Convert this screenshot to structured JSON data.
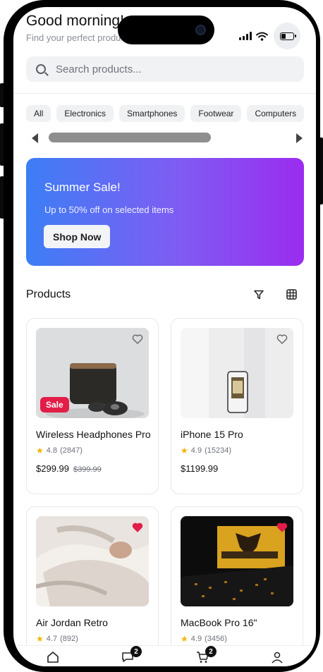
{
  "header": {
    "greeting": "Good morning!",
    "subtitle": "Find your perfect products"
  },
  "search": {
    "placeholder": "Search products..."
  },
  "categories": [
    "All",
    "Electronics",
    "Smartphones",
    "Footwear",
    "Computers"
  ],
  "banner": {
    "title": "Summer Sale!",
    "subtitle": "Up to 50% off on selected items",
    "button": "Shop Now"
  },
  "products_section": {
    "title": "Products"
  },
  "products": [
    {
      "name": "Wireless Headphones Pro",
      "rating": "4.8",
      "reviews": "(2847)",
      "price": "$299.99",
      "old_price": "$399.99",
      "badge": "Sale",
      "favorited": false
    },
    {
      "name": "iPhone 15 Pro",
      "rating": "4.9",
      "reviews": "(15234)",
      "price": "$1199.99",
      "old_price": "",
      "badge": "",
      "favorited": false
    },
    {
      "name": "Air Jordan Retro",
      "rating": "4.7",
      "reviews": "(892)",
      "price": "",
      "old_price": "",
      "badge": "",
      "favorited": true
    },
    {
      "name": "MacBook Pro 16\"",
      "rating": "4.9",
      "reviews": "(3456)",
      "price": "",
      "old_price": "",
      "badge": "",
      "favorited": true
    }
  ],
  "bottom_nav": {
    "items": [
      "home-icon",
      "chat-icon",
      "cart-icon",
      "profile-icon"
    ],
    "chat_badge": "2",
    "cart_badge": "2"
  },
  "colors": {
    "banner_start": "#3d7ef5",
    "banner_end": "#9b2cf0",
    "sale_badge": "#e11d48",
    "favorite": "#e11d48",
    "star": "#f5b400"
  }
}
